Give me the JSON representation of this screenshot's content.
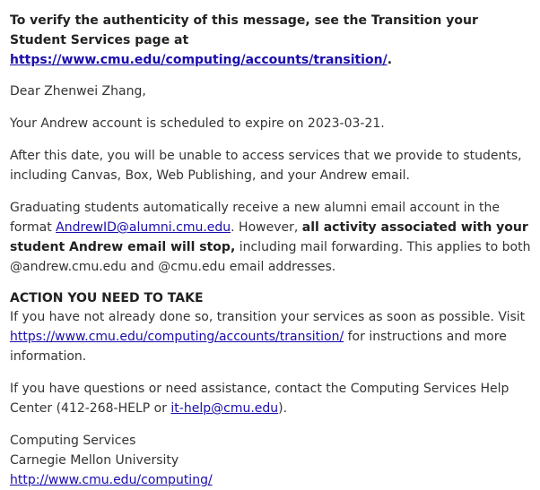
{
  "notice": {
    "text_before": "To verify the authenticity of this message, see the Transition your Student Services page at ",
    "link": "https://www.cmu.edu/computing/accounts/transition/",
    "text_after": "."
  },
  "greeting": "Dear Zhenwei Zhang,",
  "expiry": "Your Andrew account is scheduled to expire on 2023-03-21.",
  "after_date": "After this date, you will be unable to access services that we provide to students, including Canvas, Box, Web Publishing, and your Andrew email.",
  "alumni": {
    "text_before": "Graduating students automatically receive a new alumni email account in the format ",
    "email_link": "AndrewID@alumni.cmu.edu",
    "text_mid": ". However, ",
    "bold": "all activity associated with your student Andrew email will stop,",
    "text_after": " including mail forwarding. This applies to both @andrew.cmu.edu and @cmu.edu email addresses."
  },
  "action": {
    "heading": "ACTION YOU NEED TO TAKE",
    "text_before": "If you have not already done so, transition your services as soon as possible. Visit ",
    "link": "https://www.cmu.edu/computing/accounts/transition/",
    "text_after": " for instructions and more information."
  },
  "help": {
    "text_before": "If you have questions or need assistance, contact the Computing Services Help Center (412-268-HELP or ",
    "email_link": "it-help@cmu.edu",
    "text_after": ")."
  },
  "signature": {
    "line1": "Computing Services",
    "line2": "Carnegie Mellon University",
    "link": "http://www.cmu.edu/computing/"
  }
}
